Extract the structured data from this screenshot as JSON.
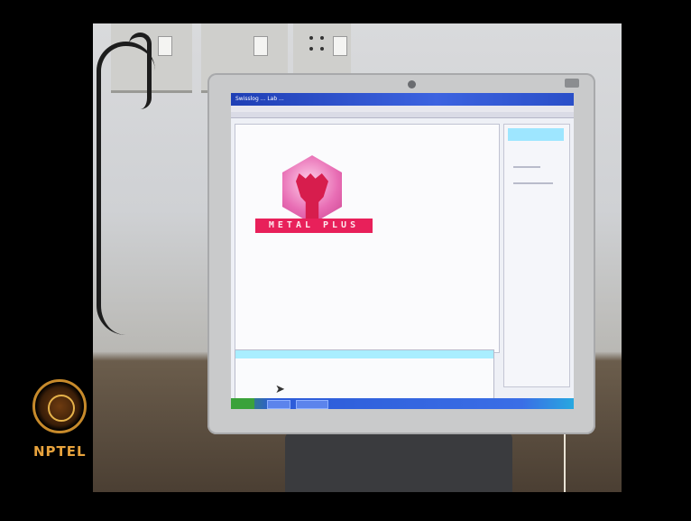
{
  "screen": {
    "window_title": "Swisslog ... Lab ...",
    "logo_text": "METAL PLUS"
  },
  "overlay": {
    "brand": "NPTEL"
  },
  "colors": {
    "titlebar": "#2a4fc8",
    "logo_pink": "#e8205a",
    "highlight": "#9ee6ff",
    "nptel_gold": "#e8a33d"
  },
  "icons": [
    "cursor-arrow-icon",
    "nptel-emblem-icon"
  ]
}
